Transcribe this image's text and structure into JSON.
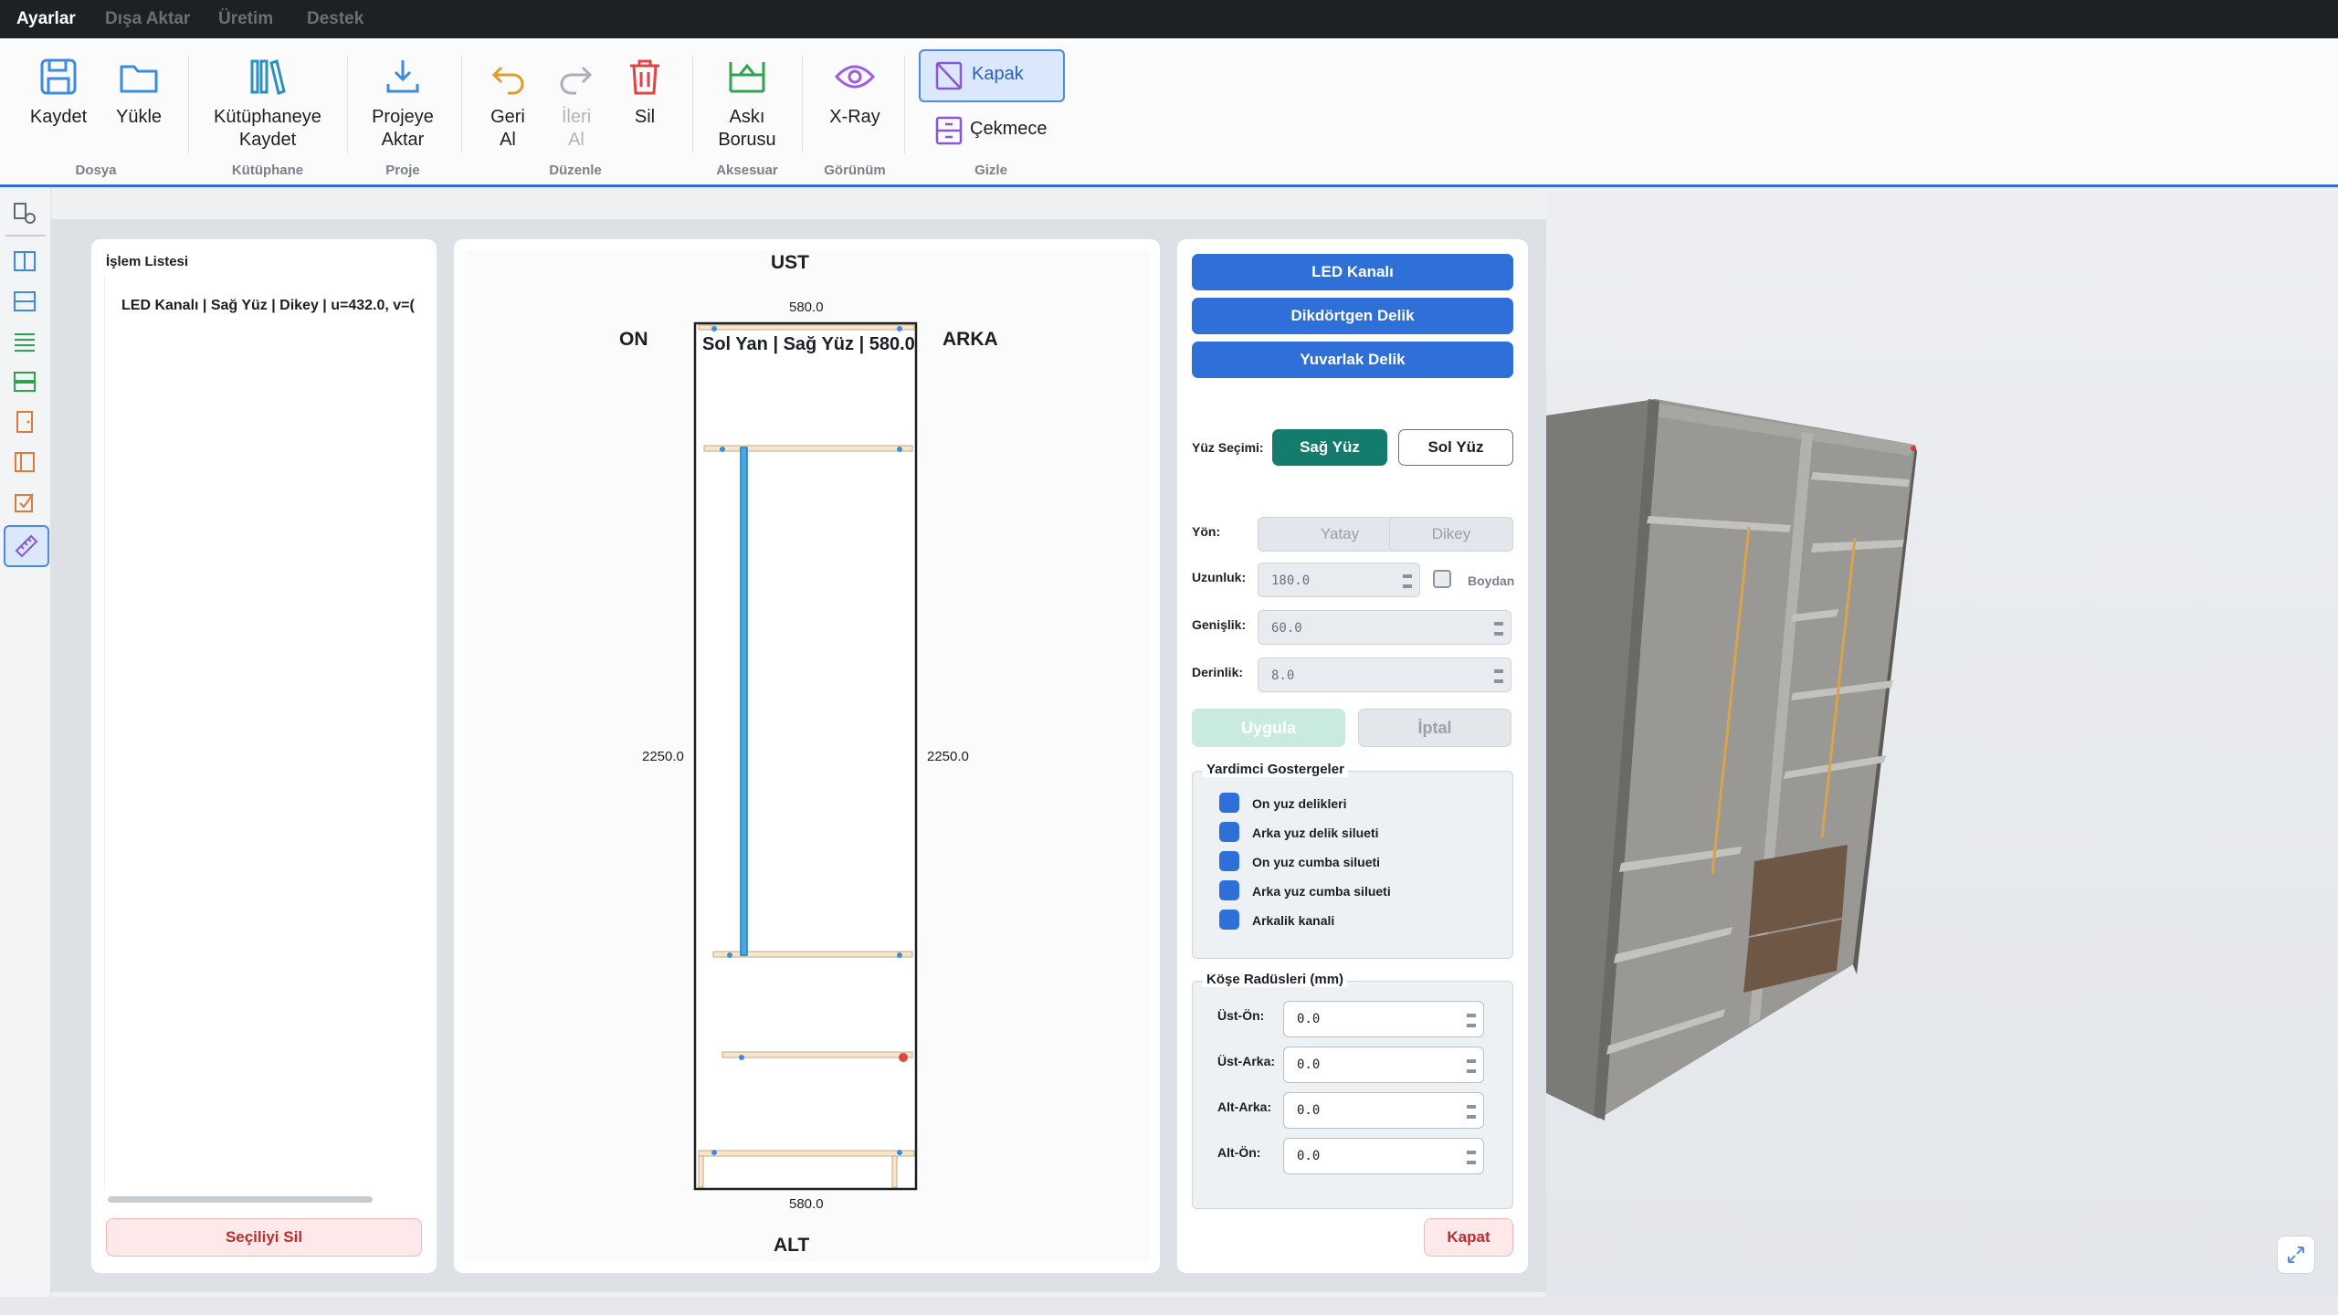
{
  "menu": [
    "Ayarlar",
    "Dışa Aktar",
    "Üretim",
    "Destek"
  ],
  "ribbon": {
    "kaydet": "Kaydet",
    "yukle": "Yükle",
    "kutuphaneye_1": "Kütüphaneye",
    "kutuphaneye_2": "Kaydet",
    "projeye_1": "Projeye",
    "projeye_2": "Aktar",
    "geri_1": "Geri",
    "geri_2": "Al",
    "ileri_1": "İleri",
    "ileri_2": "Al",
    "sil": "Sil",
    "aski_1": "Askı",
    "aski_2": "Borusu",
    "xray": "X-Ray",
    "kapak": "Kapak",
    "cekmece": "Çekmece",
    "groups": {
      "dosya": "Dosya",
      "kutuphane": "Kütüphane",
      "proje": "Proje",
      "duzenle": "Düzenle",
      "aksesuar": "Aksesuar",
      "gorunum": "Görünüm",
      "gizle": "Gizle"
    }
  },
  "operations": {
    "title": "İşlem Listesi",
    "items": [
      "LED Kanalı | Sağ Yüz | Dikey | u=432.0, v=("
    ],
    "delete_selected": "Seçiliyi Sil"
  },
  "drawing": {
    "top": "UST",
    "bottom": "ALT",
    "front": "ON",
    "back": "ARKA",
    "panel_title": "Sol Yan | Sağ Yüz | 580.0",
    "width_top": "580.0",
    "width_bottom": "580.0",
    "height_left": "2250.0",
    "height_right": "2250.0"
  },
  "props": {
    "led_button": "LED Kanalı",
    "rect_hole_button": "Dikdörtgen Delik",
    "round_hole_button": "Yuvarlak Delik",
    "face_label": "Yüz Seçimi:",
    "face_right": "Sağ Yüz",
    "face_left": "Sol Yüz",
    "direction_label": "Yön:",
    "horizontal": "Yatay",
    "vertical": "Dikey",
    "length_label": "Uzunluk:",
    "length_value": "180.0",
    "full_length": "Boydan",
    "width_label": "Genişlik:",
    "width_value": "60.0",
    "depth_label": "Derinlik:",
    "depth_value": "8.0",
    "apply": "Uygula",
    "cancel": "İptal",
    "helpers_title": "Yardimci Gostergeler",
    "helpers": [
      "On yuz delikleri",
      "Arka yuz delik silueti",
      "On yuz cumba silueti",
      "Arka yuz cumba silueti",
      "Arkalik kanali"
    ],
    "radius_title": "Köşe Radüsleri (mm)",
    "radius_labels": [
      "Üst-Ön:",
      "Üst-Arka:",
      "Alt-Arka:",
      "Alt-Ön:"
    ],
    "radius_values": [
      "0.0",
      "0.0",
      "0.0",
      "0.0"
    ],
    "close": "Kapat"
  },
  "colors": {
    "accent_blue": "#2f6fd8",
    "teal_selected": "#137c6c",
    "danger_red": "#d63a3a"
  }
}
